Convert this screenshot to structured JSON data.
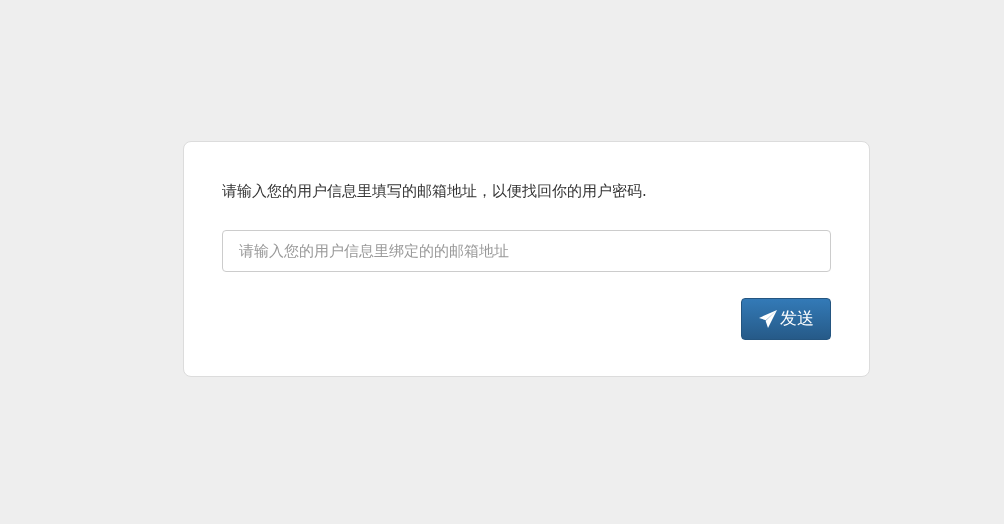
{
  "card": {
    "instruction": "请输入您的用户信息里填写的邮箱地址，以便找回你的用户密码.",
    "email_field": {
      "placeholder": "请输入您的用户信息里绑定的的邮箱地址"
    },
    "send_button": {
      "label": "发送"
    }
  }
}
